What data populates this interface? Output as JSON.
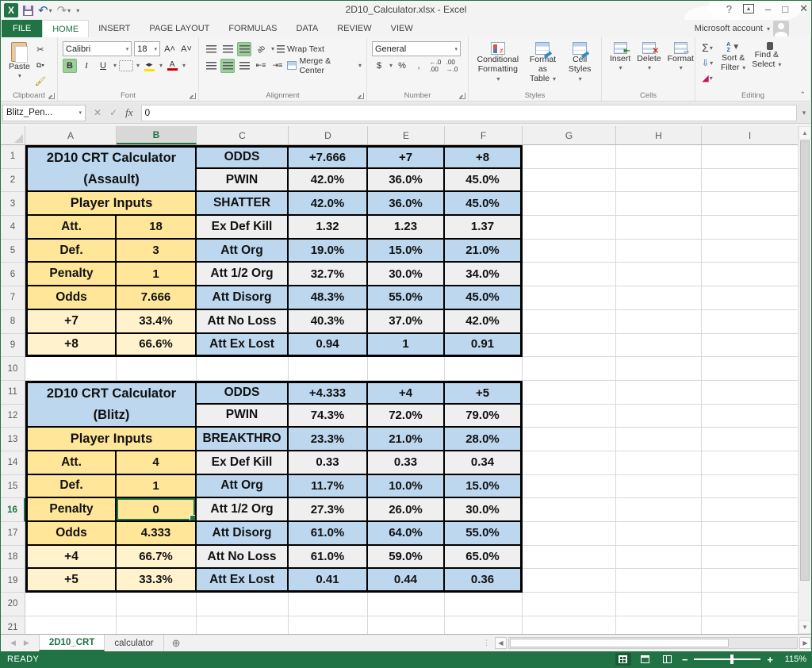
{
  "window": {
    "title": "2D10_Calculator.xlsx - Excel",
    "help": "?",
    "minimize": "–",
    "restore": "□",
    "close": "✕"
  },
  "menu": {
    "file": "FILE",
    "tabs": [
      "HOME",
      "INSERT",
      "PAGE LAYOUT",
      "FORMULAS",
      "DATA",
      "REVIEW",
      "VIEW"
    ],
    "account_label": "Microsoft account"
  },
  "ribbon": {
    "clipboard": {
      "label": "Clipboard",
      "paste": "Paste"
    },
    "font": {
      "label": "Font",
      "font_name": "Calibri",
      "font_size": "18",
      "bold": "B",
      "italic": "I",
      "underline": "U"
    },
    "alignment": {
      "label": "Alignment",
      "wrap_text": "Wrap Text",
      "merge_center": "Merge & Center"
    },
    "number": {
      "label": "Number",
      "format": "General",
      "currency": "$",
      "percent": "%",
      "comma": ","
    },
    "styles": {
      "label": "Styles",
      "conditional1": "Conditional",
      "conditional2": "Formatting",
      "format_table1": "Format as",
      "format_table2": "Table",
      "cell_styles1": "Cell",
      "cell_styles2": "Styles"
    },
    "cells": {
      "label": "Cells",
      "insert": "Insert",
      "delete": "Delete",
      "format": "Format"
    },
    "editing": {
      "label": "Editing",
      "sort1": "Sort &",
      "sort2": "Filter",
      "find1": "Find &",
      "find2": "Select"
    }
  },
  "formula_bar": {
    "name_box": "Blitz_Pen...",
    "value": "0"
  },
  "grid": {
    "columns": [
      "A",
      "B",
      "C",
      "D",
      "E",
      "F",
      "G",
      "H",
      "I"
    ],
    "selected_column": "B",
    "selected_row": 16,
    "visible_rows": 21,
    "palette": {
      "blue": "#BDD7EE",
      "yellow": "#FFE699",
      "cream": "#FFF2CC",
      "gray": "#EFEFEF",
      "selection_green": "#217346"
    },
    "rows": [
      {
        "n": 1,
        "merged": "2D10 CRT Calculator",
        "mfill": "blue",
        "c": "ODDS",
        "cfill": "blue",
        "d": "+7.666",
        "e": "+7",
        "f": "+8",
        "vfill": "blue"
      },
      {
        "n": 2,
        "merged": "(Assault)",
        "mfill": "blue",
        "c": "PWIN",
        "cfill": "gray",
        "d": "42.0%",
        "e": "36.0%",
        "f": "45.0%",
        "vfill": "gray"
      },
      {
        "n": 3,
        "merged": "Player Inputs",
        "mfill": "yellow",
        "c": "SHATTER",
        "cfill": "blue",
        "d": "42.0%",
        "e": "36.0%",
        "f": "45.0%",
        "vfill": "blue"
      },
      {
        "n": 4,
        "a": "Att.",
        "b": "18",
        "abfill": "yellow",
        "c": "Ex Def Kill",
        "cfill": "gray",
        "d": "1.32",
        "e": "1.23",
        "f": "1.37",
        "vfill": "gray"
      },
      {
        "n": 5,
        "a": "Def.",
        "b": "3",
        "abfill": "yellow",
        "c": "Att Org",
        "cfill": "blue",
        "d": "19.0%",
        "e": "15.0%",
        "f": "21.0%",
        "vfill": "blue"
      },
      {
        "n": 6,
        "a": "Penalty",
        "b": "1",
        "abfill": "yellow",
        "c": "Att 1/2 Org",
        "cfill": "gray",
        "d": "32.7%",
        "e": "30.0%",
        "f": "34.0%",
        "vfill": "gray"
      },
      {
        "n": 7,
        "a": "Odds",
        "b": "7.666",
        "abfill": "yellow",
        "c": "Att Disorg",
        "cfill": "blue",
        "d": "48.3%",
        "e": "55.0%",
        "f": "45.0%",
        "vfill": "blue"
      },
      {
        "n": 8,
        "a": "+7",
        "b": "33.4%",
        "abfill": "cream",
        "c": "Att No Loss",
        "cfill": "gray",
        "d": "40.3%",
        "e": "37.0%",
        "f": "42.0%",
        "vfill": "gray"
      },
      {
        "n": 9,
        "a": "+8",
        "b": "66.6%",
        "abfill": "cream",
        "c": "Att Ex Lost",
        "cfill": "blue",
        "d": "0.94",
        "e": "1",
        "f": "0.91",
        "vfill": "blue",
        "last": true
      },
      {
        "n": 11,
        "merged": "2D10 CRT Calculator",
        "mfill": "blue",
        "c": "ODDS",
        "cfill": "blue",
        "d": "+4.333",
        "e": "+4",
        "f": "+5",
        "vfill": "blue"
      },
      {
        "n": 12,
        "merged": "(Blitz)",
        "mfill": "blue",
        "c": "PWIN",
        "cfill": "gray",
        "d": "74.3%",
        "e": "72.0%",
        "f": "79.0%",
        "vfill": "gray"
      },
      {
        "n": 13,
        "merged": "Player Inputs",
        "mfill": "yellow",
        "c": "BREAKTHRO",
        "cfill": "blue",
        "d": "23.3%",
        "e": "21.0%",
        "f": "28.0%",
        "vfill": "blue"
      },
      {
        "n": 14,
        "a": "Att.",
        "b": "4",
        "abfill": "yellow",
        "c": "Ex Def Kill",
        "cfill": "gray",
        "d": "0.33",
        "e": "0.33",
        "f": "0.34",
        "vfill": "gray"
      },
      {
        "n": 15,
        "a": "Def.",
        "b": "1",
        "abfill": "yellow",
        "c": "Att Org",
        "cfill": "blue",
        "d": "11.7%",
        "e": "10.0%",
        "f": "15.0%",
        "vfill": "blue"
      },
      {
        "n": 16,
        "a": "Penalty",
        "b": "0",
        "abfill": "yellow",
        "c": "Att 1/2 Org",
        "cfill": "gray",
        "d": "27.3%",
        "e": "26.0%",
        "f": "30.0%",
        "vfill": "gray"
      },
      {
        "n": 17,
        "a": "Odds",
        "b": "4.333",
        "abfill": "yellow",
        "c": "Att Disorg",
        "cfill": "blue",
        "d": "61.0%",
        "e": "64.0%",
        "f": "55.0%",
        "vfill": "blue"
      },
      {
        "n": 18,
        "a": "+4",
        "b": "66.7%",
        "abfill": "cream",
        "c": "Att No Loss",
        "cfill": "gray",
        "d": "61.0%",
        "e": "59.0%",
        "f": "65.0%",
        "vfill": "gray"
      },
      {
        "n": 19,
        "a": "+5",
        "b": "33.3%",
        "abfill": "cream",
        "c": "Att Ex Lost",
        "cfill": "blue",
        "d": "0.41",
        "e": "0.44",
        "f": "0.36",
        "vfill": "blue",
        "last": true
      }
    ]
  },
  "sheet_tabs": {
    "tabs": [
      {
        "label": "2D10_CRT",
        "active": true
      },
      {
        "label": "calculator",
        "active": false
      }
    ]
  },
  "status_bar": {
    "mode": "READY",
    "zoom": "115%"
  }
}
